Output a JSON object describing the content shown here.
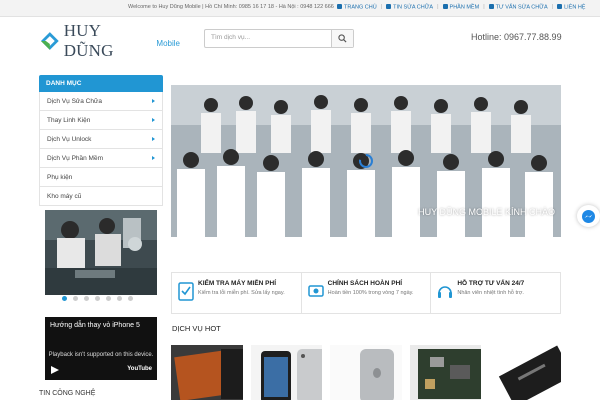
{
  "topbar": {
    "welcome": "Welcome to Huy Dũng Mobile | Hồ Chí Minh: 0985 16 17 18 - Hà Nội : 0948 122 666",
    "nav": [
      {
        "label": "TRANG CHỦ",
        "icon": "home-icon"
      },
      {
        "label": "TIN SỬA CHỮA",
        "icon": "bookmark-icon"
      },
      {
        "label": "PHẦN MỀM",
        "icon": "download-icon"
      },
      {
        "label": "TƯ VẤN SỬA CHỮA",
        "icon": "question-icon"
      },
      {
        "label": "LIÊN HỆ",
        "icon": "phone-icon"
      }
    ]
  },
  "header": {
    "logo_name": "HUY DŨNG",
    "logo_sub": "Mobile",
    "search_placeholder": "Tìm dịch vụ...",
    "hotline": "Hotline: 0967.77.88.99"
  },
  "sidebar": {
    "title": "DANH MỤC",
    "items": [
      {
        "label": "Dịch Vụ Sửa Chữa",
        "has_sub": true
      },
      {
        "label": "Thay Linh Kiện",
        "has_sub": true
      },
      {
        "label": "Dịch Vụ Unlock",
        "has_sub": true
      },
      {
        "label": "Dịch Vụ Phần Mềm",
        "has_sub": true
      },
      {
        "label": "Phụ kiện",
        "has_sub": false
      },
      {
        "label": "Kho máy cũ",
        "has_sub": false
      }
    ],
    "slider_dots": 7,
    "slider_active": 1
  },
  "video": {
    "title": "Hướng dẫn thay vỏ iPhone 5",
    "message": "Playback isn't supported on this device.",
    "brand": "YouTube"
  },
  "sections": {
    "news_title": "TIN CÔNG NGHỆ",
    "hot_title": "DỊCH VỤ HOT"
  },
  "hero": {
    "caption": "HUY DŨNG MOBILE KÍNH CHÀO"
  },
  "features": [
    {
      "title": "KIỂM TRA MÁY MIỄN PHÍ",
      "desc": "Kiểm tra lỗi miễn phí. Sửa lấy ngay.",
      "icon": "checklist-icon"
    },
    {
      "title": "CHÍNH SÁCH HOÀN PHÍ",
      "desc": "Hoàn tiền 100% trong vòng 7 ngày.",
      "icon": "money-icon"
    },
    {
      "title": "HỖ TRỢ TƯ VẤN 24/7",
      "desc": "Nhân viên nhiệt tình hỗ trợ.",
      "icon": "headset-icon"
    }
  ],
  "colors": {
    "accent": "#2196d3",
    "link": "#1b6fae"
  }
}
